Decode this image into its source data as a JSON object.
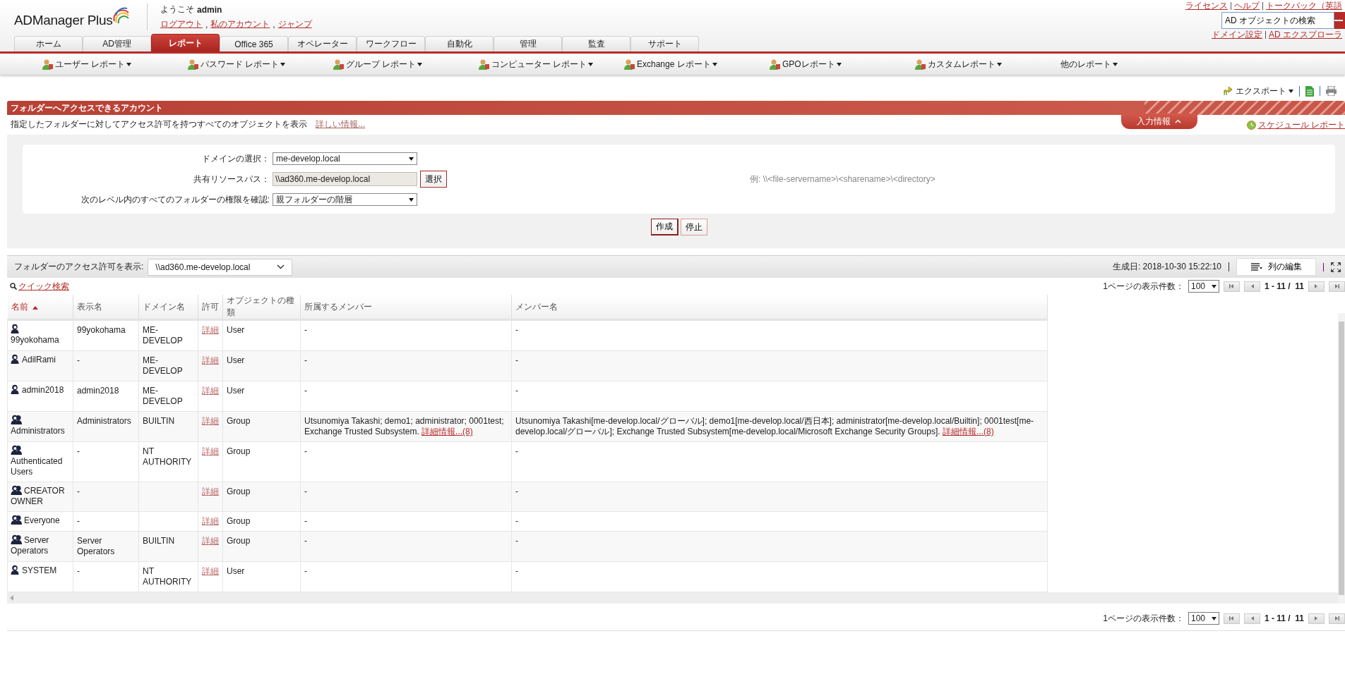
{
  "header": {
    "logo": "ADManager Plus",
    "welcome": "ようこそ",
    "user": "admin",
    "links": [
      "ログアウト",
      "私のアカウント",
      "ジャンプ"
    ],
    "link_separator": ",",
    "top_links": [
      "ライセンス",
      "ヘルプ",
      "トークバック（英語"
    ],
    "search": {
      "value": "AD オブジェクトの検索"
    },
    "bottom_links": [
      "ドメイン設定",
      "AD エクスプローラ"
    ]
  },
  "tabs": [
    {
      "label": "ホーム",
      "selected": false
    },
    {
      "label": "AD管理",
      "selected": false
    },
    {
      "label": "レポート",
      "selected": true
    },
    {
      "label": "Office 365",
      "selected": false
    },
    {
      "label": "オペレーター",
      "selected": false
    },
    {
      "label": "ワークフロー",
      "selected": false
    },
    {
      "label": "自動化",
      "selected": false
    },
    {
      "label": "管理",
      "selected": false
    },
    {
      "label": "監査",
      "selected": false
    },
    {
      "label": "サポート",
      "selected": false
    }
  ],
  "subnav": [
    {
      "label": "ユーザー レポート",
      "icon": true
    },
    {
      "label": "パスワード レポート",
      "icon": true
    },
    {
      "label": "グループ レポート",
      "icon": true
    },
    {
      "label": "コンピューター レポート",
      "icon": true
    },
    {
      "label": "Exchange レポート",
      "icon": true
    },
    {
      "label": "GPOレポート",
      "icon": true
    },
    {
      "label": "カスタムレポート",
      "icon": true
    },
    {
      "label": "他のレポート",
      "icon": false
    }
  ],
  "toolbar": {
    "export": "エクスポート"
  },
  "panel": {
    "title": "フォルダーへアクセスできるアカウント",
    "description": "指定したフォルダーに対してアクセス許可を持つすべてのオブジェクトを表示",
    "more_link": "詳しい情報...",
    "input_tab": "入力情報",
    "schedule": "スケジュール レポート"
  },
  "form": {
    "fields": [
      {
        "kind": "select",
        "label": "ドメインの選択：",
        "value": "me-develop.local"
      },
      {
        "kind": "path",
        "label": "共有リソースパス：",
        "value": "\\\\ad360.me-develop.local",
        "button": "選択"
      },
      {
        "kind": "select",
        "label": "次のレベル内のすべてのフォルダーの権限を確認:",
        "value": "親フォルダーの階層"
      }
    ],
    "hint": "例: \\\\<file-servername>\\<sharename>\\<directory>",
    "buttons": [
      {
        "label": "作成",
        "primary": true
      },
      {
        "label": "停止",
        "primary": false
      }
    ]
  },
  "results": {
    "view_label": "フォルダーのアクセス許可を表示:",
    "view_value": "\\\\ad360.me-develop.local",
    "generated": "生成日: 2018-10-30 15:22:10",
    "edit_columns": "列の編集",
    "quick_search": "クイック検索"
  },
  "pagination_top": {
    "label": "1ページの表示件数：",
    "per_page": "100",
    "range": "1 - 11 /  11"
  },
  "table": {
    "columns": [
      {
        "label": "名前",
        "sorted": true
      },
      {
        "label": "表示名",
        "sorted": false
      },
      {
        "label": "ドメイン名",
        "sorted": false
      },
      {
        "label": "許可",
        "sorted": false
      },
      {
        "label": "オブジェクトの種類",
        "sorted": false
      },
      {
        "label": "所属するメンバー",
        "sorted": false
      },
      {
        "label": "メンバー名",
        "sorted": false
      }
    ],
    "rows": [
      {
        "kind": "user",
        "name": "99yokohama",
        "display": "99yokohama",
        "domain": "ME-DEVELOP",
        "permission": "詳細",
        "type": "User",
        "members": "-",
        "member_names": "-"
      },
      {
        "kind": "user",
        "name": "AdilRami",
        "display": "-",
        "domain": "ME-DEVELOP",
        "permission": "詳細",
        "type": "User",
        "members": "-",
        "member_names": "-"
      },
      {
        "kind": "user",
        "name": "admin2018",
        "display": "admin2018",
        "domain": "ME-DEVELOP",
        "permission": "詳細",
        "type": "User",
        "members": "-",
        "member_names": "-"
      },
      {
        "kind": "group",
        "name": "Administrators",
        "display": "Administrators",
        "domain": "BUILTIN",
        "permission": "詳細",
        "type": "Group",
        "members": "Utsunomiya Takashi; demo1; administrator; 0001test; Exchange Trusted Subsystem.",
        "members_more": "詳細情報...(8)",
        "member_names": "Utsunomiya Takashi[me-develop.local/グローバル]; demo1[me-develop.local/西日本]; administrator[me-develop.local/Builtin]; 0001test[me-develop.local/グローバル]; Exchange Trusted Subsystem[me-develop.local/Microsoft Exchange Security Groups].",
        "member_names_more": "詳細情報...(8)"
      },
      {
        "kind": "group",
        "name": "Authenticated Users",
        "display": "-",
        "domain": "NT AUTHORITY",
        "permission": "詳細",
        "type": "Group",
        "members": "-",
        "member_names": "-"
      },
      {
        "kind": "group",
        "name": "CREATOR OWNER",
        "display": "-",
        "permission": "詳細",
        "type": "Group",
        "members": "-",
        "member_names": "-"
      },
      {
        "kind": "group",
        "name": "Everyone",
        "display": "-",
        "permission": "詳細",
        "type": "Group",
        "members": "-",
        "member_names": "-"
      },
      {
        "kind": "group",
        "name": "Server Operators",
        "display": "Server Operators",
        "domain": "BUILTIN",
        "permission": "詳細",
        "type": "Group",
        "members": "-",
        "member_names": "-"
      },
      {
        "kind": "user",
        "name": "SYSTEM",
        "display": "-",
        "domain": "NT AUTHORITY",
        "permission": "詳細",
        "type": "User",
        "members": "-",
        "member_names": "-"
      }
    ]
  },
  "pagination_bottom": {
    "label": "1ページの表示件数：",
    "per_page": "100",
    "range": "1 - 11 /  11"
  }
}
